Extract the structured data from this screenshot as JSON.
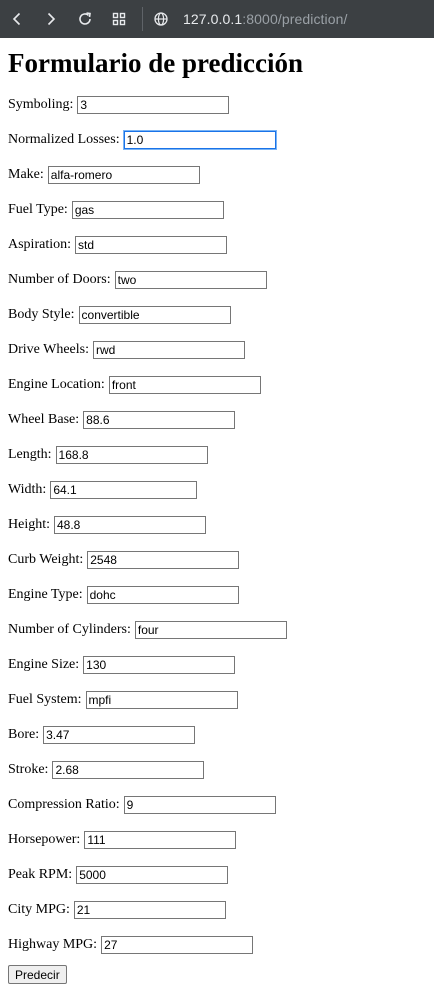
{
  "browser": {
    "url_host": "127.0.0.1",
    "url_rest": ":8000/prediction/",
    "icons": [
      "back-icon",
      "forward-icon",
      "reload-icon",
      "apps-icon",
      "site-info-icon"
    ]
  },
  "page": {
    "title": "Formulario de predicción"
  },
  "fields": [
    {
      "label": "Symboling:",
      "value": "3"
    },
    {
      "label": "Normalized Losses:",
      "value": "1.0"
    },
    {
      "label": "Make:",
      "value": "alfa-romero"
    },
    {
      "label": "Fuel Type:",
      "value": "gas"
    },
    {
      "label": "Aspiration:",
      "value": "std"
    },
    {
      "label": "Number of Doors:",
      "value": "two"
    },
    {
      "label": "Body Style:",
      "value": "convertible"
    },
    {
      "label": "Drive Wheels:",
      "value": "rwd"
    },
    {
      "label": "Engine Location:",
      "value": "front"
    },
    {
      "label": "Wheel Base:",
      "value": "88.6"
    },
    {
      "label": "Length:",
      "value": "168.8"
    },
    {
      "label": "Width:",
      "value": "64.1"
    },
    {
      "label": "Height:",
      "value": "48.8"
    },
    {
      "label": "Curb Weight:",
      "value": "2548"
    },
    {
      "label": "Engine Type:",
      "value": "dohc"
    },
    {
      "label": "Number of Cylinders:",
      "value": "four"
    },
    {
      "label": "Engine Size:",
      "value": "130"
    },
    {
      "label": "Fuel System:",
      "value": "mpfi"
    },
    {
      "label": "Bore:",
      "value": "3.47"
    },
    {
      "label": "Stroke:",
      "value": "2.68"
    },
    {
      "label": "Compression Ratio:",
      "value": "9"
    },
    {
      "label": "Horsepower:",
      "value": "111"
    },
    {
      "label": "Peak RPM:",
      "value": "5000"
    },
    {
      "label": "City MPG:",
      "value": "21"
    },
    {
      "label": "Highway MPG:",
      "value": "27"
    }
  ],
  "submit_label": "Predecir"
}
